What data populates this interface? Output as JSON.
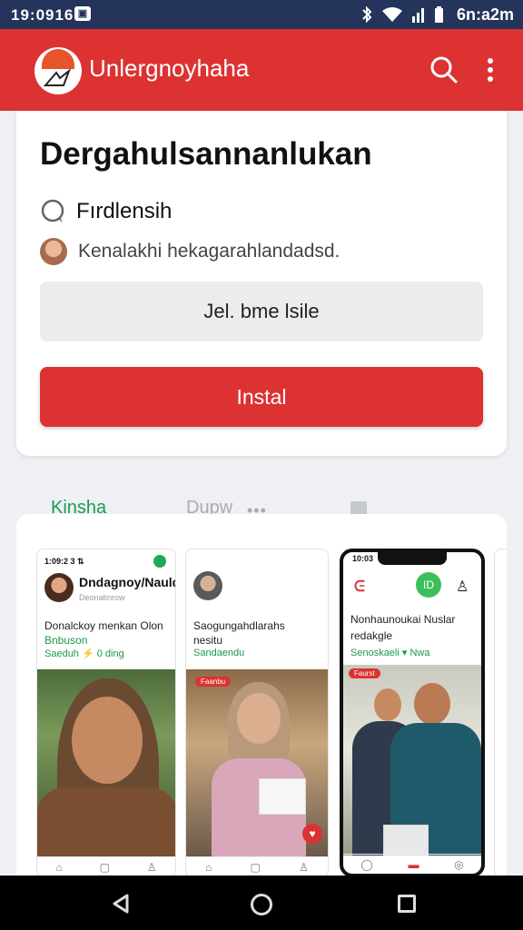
{
  "status_bar": {
    "time_left": "19:0916",
    "notif_glyph": "▣",
    "icons": [
      "bluetooth-icon",
      "wifi-icon",
      "signal-icon",
      "battery-icon"
    ],
    "clock": "6n:a2m"
  },
  "app_bar": {
    "title": "Unlergnoyhaha",
    "color": "#dc3232"
  },
  "card": {
    "heading": "Dergahulsannanlukan",
    "rating_text": "Fırdlensih",
    "user_text": "Kenalakhi hekagarahlandadsd.",
    "field_text": "Jel. bme lsile",
    "install_label": "Instal"
  },
  "tabs": {
    "active": "Kinsha",
    "second": "Dupw",
    "dots": "•••",
    "active_color": "#1f9a52"
  },
  "screenshots": [
    {
      "status": "1:09:2 3 ⇅",
      "name": "Dndagnoy/Nauld",
      "sub": "Deonatinrow",
      "text": "Donalckoy menkan Olon",
      "text2": "Bnbuson",
      "meta": "Saeduh ⚡ 0 ding"
    },
    {
      "name": "",
      "text": "Saogungahdlarahs",
      "text2": "nesitu",
      "meta": "Sandaendu",
      "badge": "Faanbu"
    },
    {
      "status": "10:03",
      "text": "Nonhaunoukai Nuslar",
      "text2": "redakgle",
      "meta": "Senoskaeli ▾ Nwa",
      "badge": "Faurst",
      "green_btn": "ID"
    }
  ]
}
